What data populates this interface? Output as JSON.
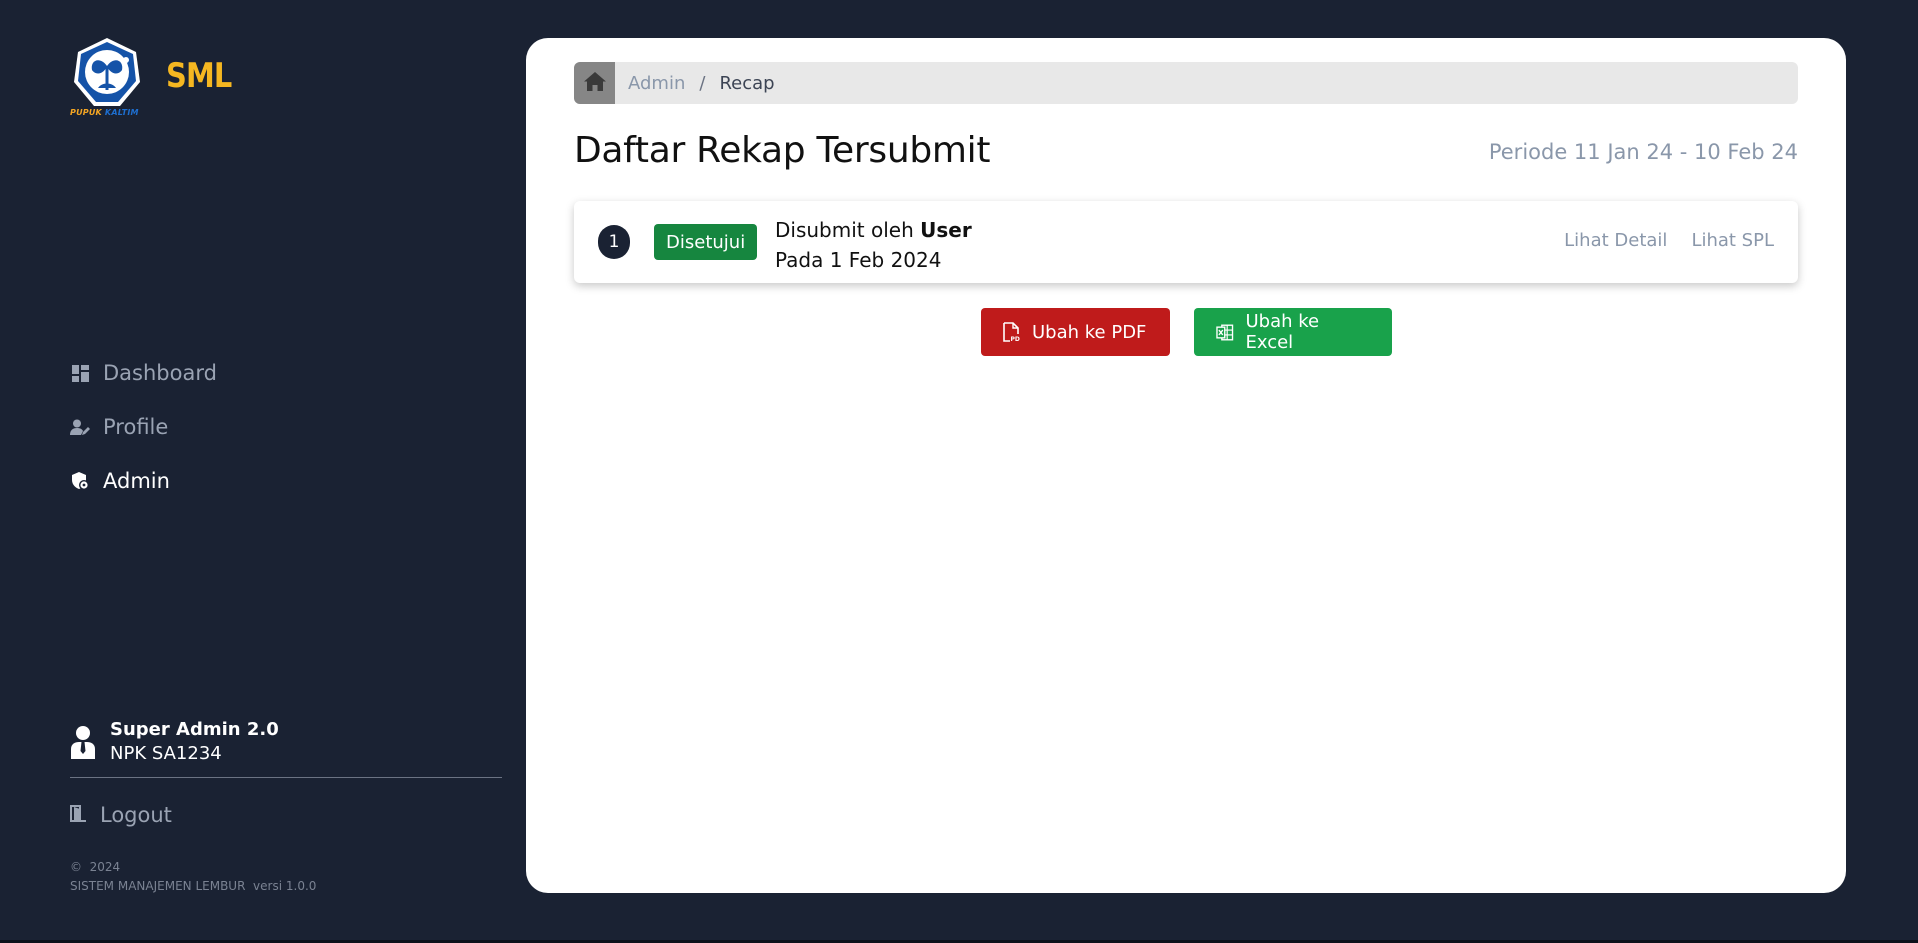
{
  "brand": {
    "name": "SML",
    "logo_caption_1": "PUPUK",
    "logo_caption_2": "KALTIM"
  },
  "sidebar": {
    "items": [
      {
        "label": "Dashboard",
        "icon": "dashboard-icon",
        "active": false
      },
      {
        "label": "Profile",
        "icon": "user-edit-icon",
        "active": false
      },
      {
        "label": "Admin",
        "icon": "shield-gear-icon",
        "active": true
      }
    ],
    "user": {
      "name": "Super Admin 2.0",
      "npk": "NPK SA1234"
    },
    "logout_label": "Logout",
    "footer": {
      "copyright": "©  2024",
      "app_name": "SISTEM MANAJEMEN LEMBUR  versi 1.0.0"
    }
  },
  "breadcrumb": {
    "parent": "Admin",
    "separator": "/",
    "current": "Recap"
  },
  "page": {
    "title": "Daftar Rekap Tersubmit",
    "periode": "Periode 11 Jan 24 - 10 Feb 24"
  },
  "recaps": [
    {
      "number": "1",
      "status": "Disetujui",
      "submitted_prefix": "Disubmit oleh ",
      "submitted_by": "User",
      "date_text": "Pada 1 Feb 2024",
      "detail_link": "Lihat Detail",
      "spl_link": "Lihat SPL"
    }
  ],
  "actions": {
    "pdf_label": "Ubah ke PDF",
    "excel_label": "Ubah ke Excel"
  },
  "colors": {
    "background": "#1a2233",
    "brand_yellow": "#f5b721",
    "approved_green": "#16863f",
    "pdf_red": "#bf1b1b",
    "excel_green": "#19a24b",
    "muted_link": "#8a97aa"
  }
}
